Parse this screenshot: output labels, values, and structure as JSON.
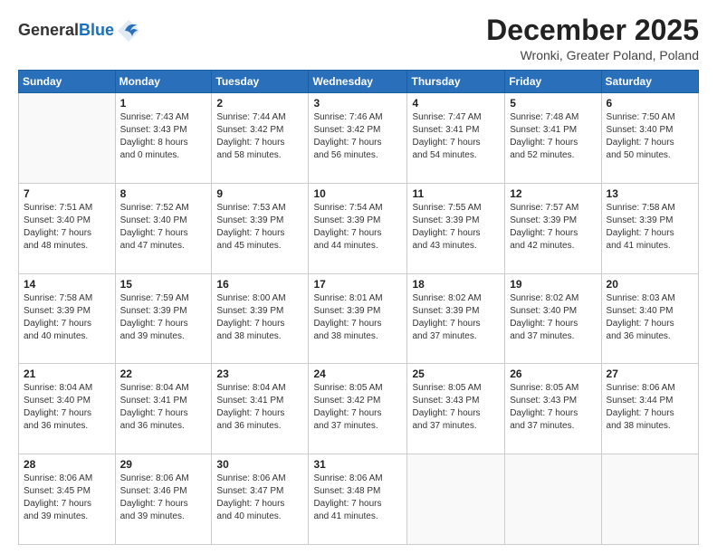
{
  "header": {
    "logo_general": "General",
    "logo_blue": "Blue",
    "month": "December 2025",
    "location": "Wronki, Greater Poland, Poland"
  },
  "days_of_week": [
    "Sunday",
    "Monday",
    "Tuesday",
    "Wednesday",
    "Thursday",
    "Friday",
    "Saturday"
  ],
  "weeks": [
    [
      {
        "day": "",
        "info": ""
      },
      {
        "day": "1",
        "info": "Sunrise: 7:43 AM\nSunset: 3:43 PM\nDaylight: 8 hours\nand 0 minutes."
      },
      {
        "day": "2",
        "info": "Sunrise: 7:44 AM\nSunset: 3:42 PM\nDaylight: 7 hours\nand 58 minutes."
      },
      {
        "day": "3",
        "info": "Sunrise: 7:46 AM\nSunset: 3:42 PM\nDaylight: 7 hours\nand 56 minutes."
      },
      {
        "day": "4",
        "info": "Sunrise: 7:47 AM\nSunset: 3:41 PM\nDaylight: 7 hours\nand 54 minutes."
      },
      {
        "day": "5",
        "info": "Sunrise: 7:48 AM\nSunset: 3:41 PM\nDaylight: 7 hours\nand 52 minutes."
      },
      {
        "day": "6",
        "info": "Sunrise: 7:50 AM\nSunset: 3:40 PM\nDaylight: 7 hours\nand 50 minutes."
      }
    ],
    [
      {
        "day": "7",
        "info": "Sunrise: 7:51 AM\nSunset: 3:40 PM\nDaylight: 7 hours\nand 48 minutes."
      },
      {
        "day": "8",
        "info": "Sunrise: 7:52 AM\nSunset: 3:40 PM\nDaylight: 7 hours\nand 47 minutes."
      },
      {
        "day": "9",
        "info": "Sunrise: 7:53 AM\nSunset: 3:39 PM\nDaylight: 7 hours\nand 45 minutes."
      },
      {
        "day": "10",
        "info": "Sunrise: 7:54 AM\nSunset: 3:39 PM\nDaylight: 7 hours\nand 44 minutes."
      },
      {
        "day": "11",
        "info": "Sunrise: 7:55 AM\nSunset: 3:39 PM\nDaylight: 7 hours\nand 43 minutes."
      },
      {
        "day": "12",
        "info": "Sunrise: 7:57 AM\nSunset: 3:39 PM\nDaylight: 7 hours\nand 42 minutes."
      },
      {
        "day": "13",
        "info": "Sunrise: 7:58 AM\nSunset: 3:39 PM\nDaylight: 7 hours\nand 41 minutes."
      }
    ],
    [
      {
        "day": "14",
        "info": "Sunrise: 7:58 AM\nSunset: 3:39 PM\nDaylight: 7 hours\nand 40 minutes."
      },
      {
        "day": "15",
        "info": "Sunrise: 7:59 AM\nSunset: 3:39 PM\nDaylight: 7 hours\nand 39 minutes."
      },
      {
        "day": "16",
        "info": "Sunrise: 8:00 AM\nSunset: 3:39 PM\nDaylight: 7 hours\nand 38 minutes."
      },
      {
        "day": "17",
        "info": "Sunrise: 8:01 AM\nSunset: 3:39 PM\nDaylight: 7 hours\nand 38 minutes."
      },
      {
        "day": "18",
        "info": "Sunrise: 8:02 AM\nSunset: 3:39 PM\nDaylight: 7 hours\nand 37 minutes."
      },
      {
        "day": "19",
        "info": "Sunrise: 8:02 AM\nSunset: 3:40 PM\nDaylight: 7 hours\nand 37 minutes."
      },
      {
        "day": "20",
        "info": "Sunrise: 8:03 AM\nSunset: 3:40 PM\nDaylight: 7 hours\nand 36 minutes."
      }
    ],
    [
      {
        "day": "21",
        "info": "Sunrise: 8:04 AM\nSunset: 3:40 PM\nDaylight: 7 hours\nand 36 minutes."
      },
      {
        "day": "22",
        "info": "Sunrise: 8:04 AM\nSunset: 3:41 PM\nDaylight: 7 hours\nand 36 minutes."
      },
      {
        "day": "23",
        "info": "Sunrise: 8:04 AM\nSunset: 3:41 PM\nDaylight: 7 hours\nand 36 minutes."
      },
      {
        "day": "24",
        "info": "Sunrise: 8:05 AM\nSunset: 3:42 PM\nDaylight: 7 hours\nand 37 minutes."
      },
      {
        "day": "25",
        "info": "Sunrise: 8:05 AM\nSunset: 3:43 PM\nDaylight: 7 hours\nand 37 minutes."
      },
      {
        "day": "26",
        "info": "Sunrise: 8:05 AM\nSunset: 3:43 PM\nDaylight: 7 hours\nand 37 minutes."
      },
      {
        "day": "27",
        "info": "Sunrise: 8:06 AM\nSunset: 3:44 PM\nDaylight: 7 hours\nand 38 minutes."
      }
    ],
    [
      {
        "day": "28",
        "info": "Sunrise: 8:06 AM\nSunset: 3:45 PM\nDaylight: 7 hours\nand 39 minutes."
      },
      {
        "day": "29",
        "info": "Sunrise: 8:06 AM\nSunset: 3:46 PM\nDaylight: 7 hours\nand 39 minutes."
      },
      {
        "day": "30",
        "info": "Sunrise: 8:06 AM\nSunset: 3:47 PM\nDaylight: 7 hours\nand 40 minutes."
      },
      {
        "day": "31",
        "info": "Sunrise: 8:06 AM\nSunset: 3:48 PM\nDaylight: 7 hours\nand 41 minutes."
      },
      {
        "day": "",
        "info": ""
      },
      {
        "day": "",
        "info": ""
      },
      {
        "day": "",
        "info": ""
      }
    ]
  ]
}
